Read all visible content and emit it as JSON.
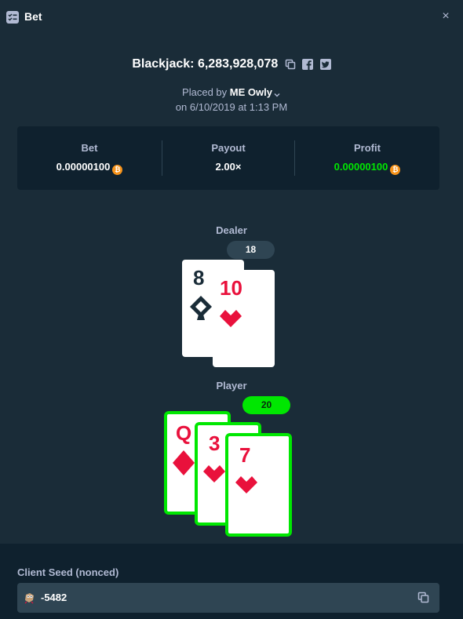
{
  "header": {
    "title": "Bet",
    "icon": "bet-list-icon",
    "close_label": "×"
  },
  "game": {
    "title": "Blackjack: 6,283,928,078",
    "icons": [
      "copy-icon",
      "facebook-icon",
      "twitter-icon"
    ]
  },
  "placed": {
    "prefix": "Placed by",
    "user": "ME Owly",
    "date": "on 6/10/2019 at 1:13 PM"
  },
  "stats": {
    "bet": {
      "label": "Bet",
      "value": "0.00000100",
      "currency_icon": "bitcoin-icon"
    },
    "payout": {
      "label": "Payout",
      "value": "2.00×"
    },
    "profit": {
      "label": "Profit",
      "value": "0.00000100",
      "currency_icon": "bitcoin-icon",
      "color": "#00e701"
    }
  },
  "dealer": {
    "label": "Dealer",
    "score": "18",
    "cards": [
      {
        "rank": "8",
        "suit": "spades",
        "color": "#1a2c38"
      },
      {
        "rank": "10",
        "suit": "hearts",
        "color": "#e9113c"
      }
    ]
  },
  "player": {
    "label": "Player",
    "score": "20",
    "result_color": "#00e701",
    "cards": [
      {
        "rank": "Q",
        "suit": "diamonds",
        "color": "#e9113c"
      },
      {
        "rank": "3",
        "suit": "hearts",
        "color": "#e9113c"
      },
      {
        "rank": "7",
        "suit": "hearts",
        "color": "#e9113c"
      }
    ]
  },
  "seed": {
    "label": "Client Seed (nonced)",
    "value": "-5482",
    "icon": "owl-icon",
    "copy_icon": "copy-icon"
  }
}
